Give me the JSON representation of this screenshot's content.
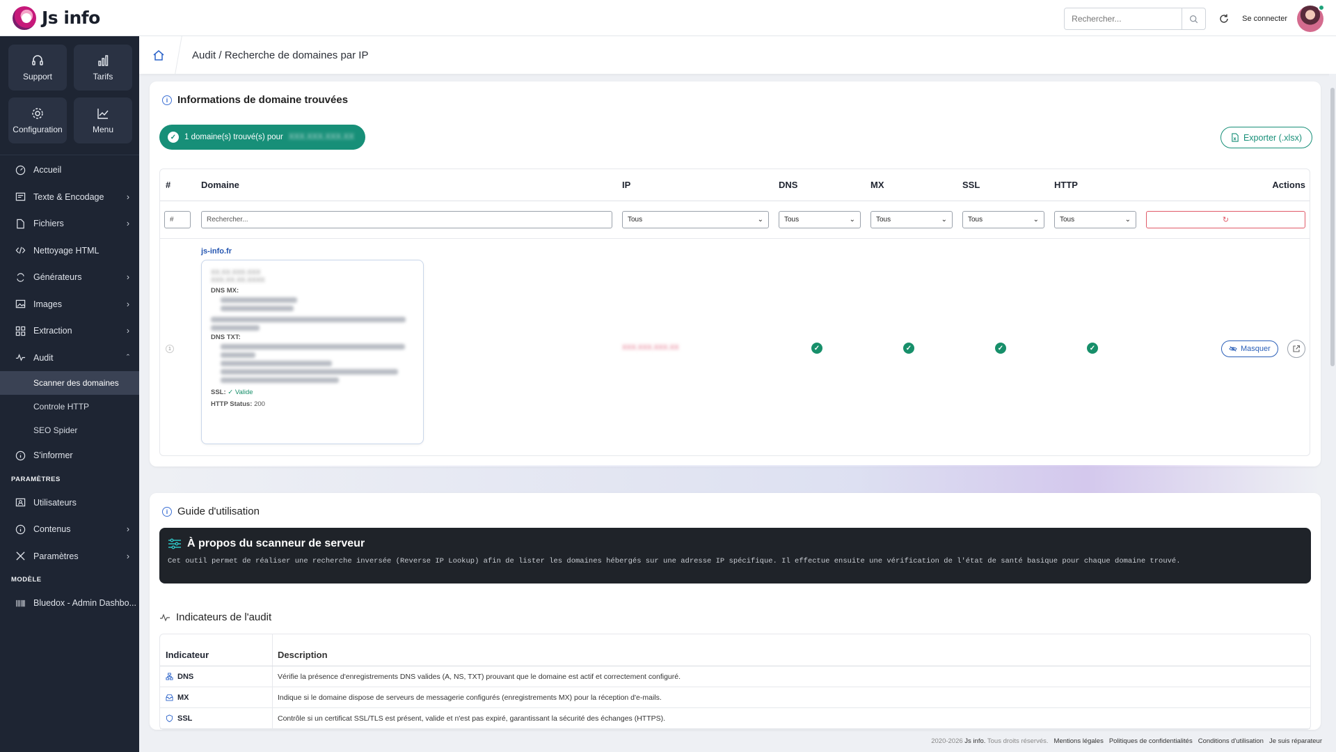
{
  "app": {
    "name": "Js info"
  },
  "topbar": {
    "search_placeholder": "Rechercher...",
    "connect_label": "Se connecter"
  },
  "quick": [
    {
      "label": "Support",
      "icon": "headset-icon"
    },
    {
      "label": "Tarifs",
      "icon": "bar-chart-icon"
    },
    {
      "label": "Configuration",
      "icon": "gear-icon"
    },
    {
      "label": "Menu",
      "icon": "trend-chart-icon"
    }
  ],
  "nav": {
    "accueil": "Accueil",
    "texte": "Texte & Encodage",
    "fichiers": "Fichiers",
    "nettoyage": "Nettoyage HTML",
    "generateurs": "Générateurs",
    "images": "Images",
    "extraction": "Extraction",
    "audit": "Audit",
    "scanner": "Scanner des domaines",
    "controle": "Controle HTTP",
    "seo": "SEO Spider",
    "informer": "S'informer",
    "parametres_section": "PARAMÈTRES",
    "utilisateurs": "Utilisateurs",
    "contenus": "Contenus",
    "parametres": "Paramètres",
    "modele_section": "MODÈLE",
    "bluedox": "Bluedox - Admin Dashbo..."
  },
  "breadcrumb": {
    "text": "Audit / Recherche de domaines par IP"
  },
  "results": {
    "title": "Informations de domaine trouvées",
    "badge_text": "1 domaine(s) trouvé(s) pour",
    "badge_ip": "XXX.XXX.XXX.XX",
    "export_label": "Exporter (.xlsx)",
    "columns": {
      "num": "#",
      "domain": "Domaine",
      "ip": "IP",
      "dns": "DNS",
      "mx": "MX",
      "ssl": "SSL",
      "http": "HTTP",
      "actions": "Actions"
    },
    "filters": {
      "num_placeholder": "#",
      "domain_placeholder": "Rechercher...",
      "ip": "Tous",
      "dns": "Tous",
      "mx": "Tous",
      "ssl": "Tous",
      "http": "Tous"
    },
    "row": {
      "num": "1",
      "domain": "js-info.fr",
      "ip_blurred": "XXX.XXX.XXX.XX",
      "detail": {
        "a1": "XX.XX.XXX.XXX",
        "a2": "XXX.XX.XX.XXXX",
        "dns_mx_label": "DNS MX:",
        "dns_txt_label": "DNS TXT:",
        "ssl_label": "SSL:",
        "ssl_value": "✓ Valide",
        "http_label": "HTTP Status:",
        "http_value": "200"
      },
      "hide_label": "Masquer"
    }
  },
  "guide": {
    "title": "Guide d'utilisation",
    "about_title": "À propos du scanneur de serveur",
    "about_text": "Cet outil permet de réaliser une recherche inversée (Reverse IP Lookup) afin de lister les domaines hébergés sur une adresse IP spécifique. Il effectue ensuite une vérification de l'état de santé basique pour chaque domaine trouvé.",
    "indicators_title": "Indicateurs de l'audit",
    "table_headers": {
      "indicator": "Indicateur",
      "description": "Description"
    },
    "rows": [
      {
        "name": "DNS",
        "icon": "network-icon",
        "desc": "Vérifie la présence d'enregistrements DNS valides (A, NS, TXT) prouvant que le domaine est actif et correctement configuré."
      },
      {
        "name": "MX",
        "icon": "inbox-icon",
        "desc": "Indique si le domaine dispose de serveurs de messagerie configurés (enregistrements MX) pour la réception d'e-mails."
      },
      {
        "name": "SSL",
        "icon": "shield-icon",
        "desc": "Contrôle si un certificat SSL/TLS est présent, valide et n'est pas expiré, garantissant la sécurité des échanges (HTTPS)."
      }
    ]
  },
  "footer": {
    "copyright_year": "2020-2026",
    "copyright_brand": "Js info.",
    "copyright_rights": "Tous droits réservés.",
    "legal": "Mentions légales",
    "privacy": "Politiques de confidentialités",
    "terms": "Conditions d'utilisation",
    "repair": "Je suis réparateur"
  },
  "colors": {
    "sidebar": "#1e2533",
    "accent_green": "#178f78",
    "link_blue": "#2455b0",
    "danger": "#e05a68"
  }
}
